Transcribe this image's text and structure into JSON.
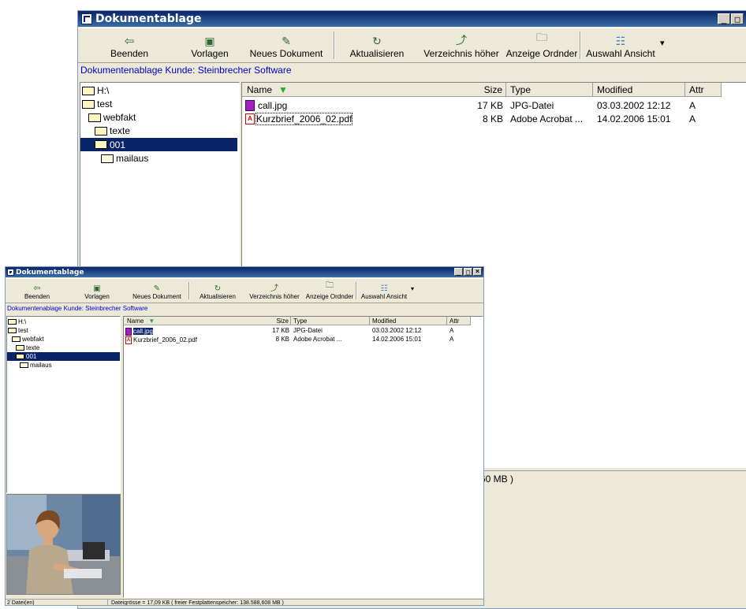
{
  "window": {
    "title": "Dokumentablage",
    "controls": {
      "minimize": "_",
      "maximize": "□",
      "close": "×"
    }
  },
  "toolbar": {
    "buttons": [
      {
        "label": "Beenden",
        "icon": "exit-icon",
        "glyph": "⇦"
      },
      {
        "label": "Vorlagen",
        "icon": "templates-icon",
        "glyph": "▣"
      },
      {
        "label": "Neues Dokument",
        "icon": "new-document-icon",
        "glyph": "✎"
      },
      {
        "label": "Aktualisieren",
        "icon": "refresh-icon",
        "glyph": "↻"
      },
      {
        "label": "Verzeichnis höher",
        "icon": "folder-up-icon",
        "glyph": "⤴"
      },
      {
        "label": "Anzeige Ordnder",
        "icon": "show-folders-icon",
        "glyph": "🗀"
      },
      {
        "label": "Auswahl Ansicht",
        "icon": "view-select-icon",
        "glyph": "☷"
      }
    ],
    "dropdown_glyph": "▾"
  },
  "customer_line": "Dokumentenablage Kunde: Steinbrecher Software",
  "tree": [
    {
      "label": "H:\\",
      "state": "open"
    },
    {
      "label": "test",
      "state": "open"
    },
    {
      "label": "webfakt",
      "state": "open"
    },
    {
      "label": "texte",
      "state": "open"
    },
    {
      "label": "001",
      "state": "open"
    },
    {
      "label": "mailaus",
      "state": "closed"
    }
  ],
  "list": {
    "columns": {
      "name": "Name",
      "size": "Size",
      "type": "Type",
      "modified": "Modified",
      "attr": "Attr"
    },
    "sort_glyph": "▼",
    "rows": [
      {
        "name": "call.jpg",
        "size": "17 KB",
        "type": "JPG-Datei",
        "modified": "03.03.2002 12:12",
        "attr": "A",
        "icon": "jpg-file-icon"
      },
      {
        "name": "Kurzbrief_2006_02.pdf",
        "size": "8 KB",
        "type": "Adobe Acrobat ...",
        "modified": "14.02.2006 15:01",
        "attr": "A",
        "icon": "pdf-file-icon"
      }
    ]
  },
  "status": {
    "count": "2 Datei(en)",
    "info": "Dateigrösse = 17,09 KB  ( freier Festplattenspeicher: 138.588,608 MB )",
    "big_fragment": "60 MB )"
  },
  "colors": {
    "title_bar": "#0a246a",
    "selection": "#0a246a",
    "customer_text": "#0000cc",
    "chrome": "#ece9d8"
  }
}
